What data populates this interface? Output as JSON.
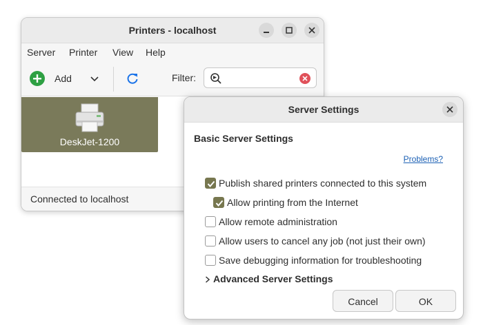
{
  "printers_window": {
    "title": "Printers - localhost",
    "menu": [
      "Server",
      "Printer",
      "View",
      "Help"
    ],
    "toolbar": {
      "add_label": "Add",
      "filter_label": "Filter:",
      "filter_value": ""
    },
    "printers": [
      {
        "name": "DeskJet-1200"
      }
    ],
    "status": "Connected to localhost"
  },
  "server_settings": {
    "title": "Server Settings",
    "section_heading": "Basic Server Settings",
    "problems_link": "Problems?",
    "options": [
      {
        "label": "Publish shared printers connected to this system",
        "checked": true
      },
      {
        "label": "Allow printing from the Internet",
        "checked": true
      },
      {
        "label": "Allow remote administration",
        "checked": false
      },
      {
        "label": "Allow users to cancel any job (not just their own)",
        "checked": false
      },
      {
        "label": "Save debugging information for troubleshooting",
        "checked": false
      }
    ],
    "advanced_label": "Advanced Server Settings",
    "cancel_label": "Cancel",
    "ok_label": "OK"
  },
  "colors": {
    "accent": "#77774f",
    "selected_tile": "#7a7a5a",
    "add_icon": "#2ea043",
    "refresh_icon": "#1a73e8",
    "clear_icon": "#e0515a",
    "link": "#1a5fb4"
  },
  "icons": {
    "add": "add-circle-icon",
    "dropdown": "chevron-down-icon",
    "refresh": "refresh-icon",
    "search": "search-icon",
    "clear": "clear-icon",
    "printer": "printer-icon",
    "minimize": "minimize-icon",
    "maximize": "maximize-icon",
    "close": "close-icon",
    "expander": "chevron-right-icon"
  }
}
